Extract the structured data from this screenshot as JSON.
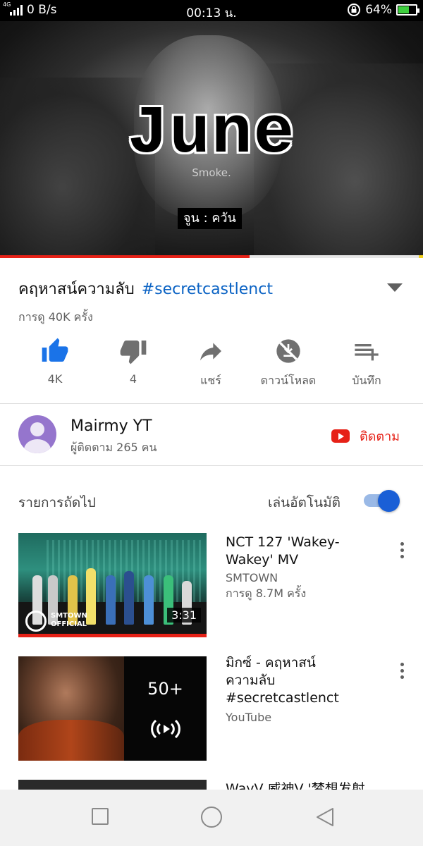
{
  "status_bar": {
    "network_type": "4G",
    "net_speed": "0 B/s",
    "time": "00:13 น.",
    "battery_percent": "64%",
    "battery_level": 0.64
  },
  "video": {
    "overlay_title": "June",
    "overlay_subtitle": "Smoke.",
    "caption": "จูน : ควัน",
    "progress": 0.59
  },
  "info": {
    "title": "คฤหาสน์ความลับ",
    "hashtag": "#secretcastlenct",
    "views": "การดู 40K ครั้ง"
  },
  "actions": [
    {
      "label": "4K",
      "icon": "thumbs-up-icon",
      "color": "#1a73e8"
    },
    {
      "label": "4",
      "icon": "thumbs-down-icon",
      "color": "#707070"
    },
    {
      "label": "แชร์",
      "icon": "share-icon",
      "color": "#707070"
    },
    {
      "label": "ดาวน์โหลด",
      "icon": "download-disabled-icon",
      "color": "#707070"
    },
    {
      "label": "บันทึก",
      "icon": "save-playlist-icon",
      "color": "#707070"
    }
  ],
  "channel": {
    "name": "Mairmy YT",
    "subscribers": "ผู้ติดตาม 265 คน",
    "subscribe_label": "ติดตาม"
  },
  "up_next": {
    "label": "รายการถัดไป",
    "autoplay_label": "เล่นอัตโนมัติ",
    "autoplay_on": true
  },
  "items": [
    {
      "title_line1": "NCT 127 'Wakey-",
      "title_line2": "Wakey' MV",
      "channel": "SMTOWN",
      "views": "การดู 8.7M ครั้ง",
      "duration": "3:31",
      "logo_text_1": "SMTOWN",
      "logo_text_2": "OFFICIAL"
    },
    {
      "title_line1": "มิกซ์ - คฤหาสน์",
      "title_line2": "ความลับ",
      "title_line3": "#secretcastlenct",
      "channel": "YouTube",
      "mix_count": "50+"
    },
    {
      "title": "WayV 威神V '梦想发射"
    }
  ],
  "colors": {
    "accent_blue": "#1a73e8",
    "youtube_red": "#e62117",
    "link_blue": "#0b63c4"
  }
}
